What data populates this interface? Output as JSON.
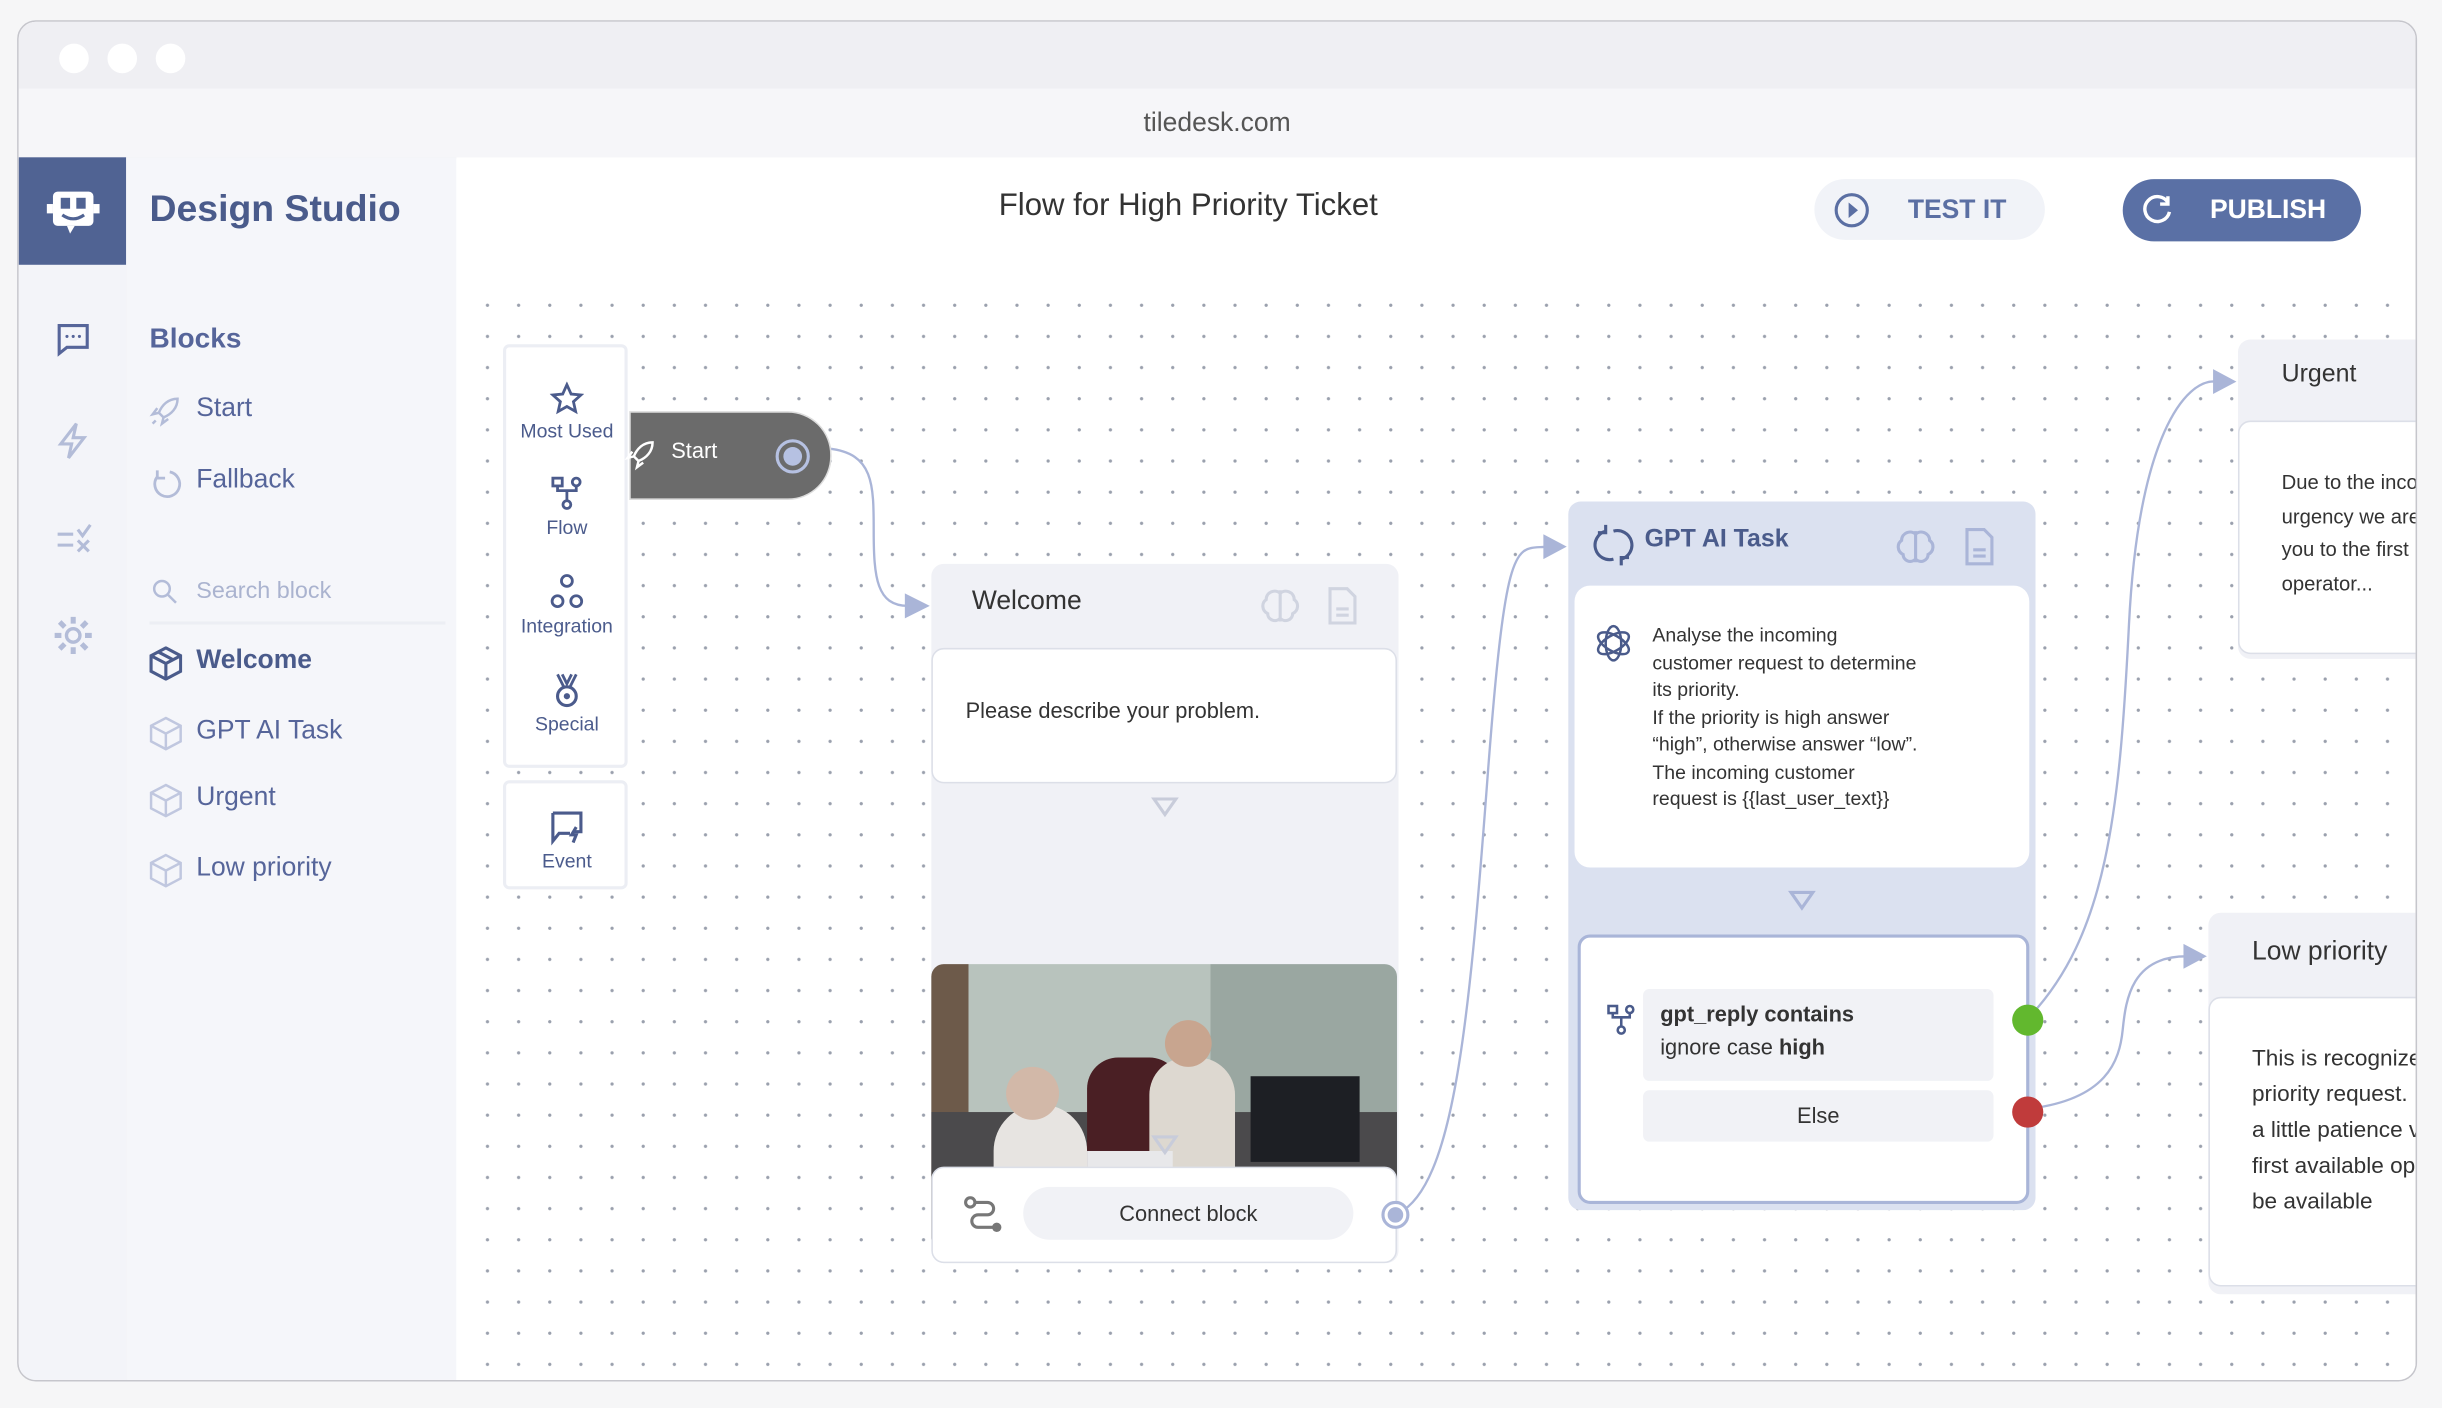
{
  "browser": {
    "url": "tiledesk.com"
  },
  "app": {
    "title": "Design Studio"
  },
  "sidebar": {
    "section": "Blocks",
    "fixed": [
      {
        "label": "Start",
        "icon": "rocket-icon"
      },
      {
        "label": "Fallback",
        "icon": "refresh-icon"
      }
    ],
    "search_placeholder": "Search block",
    "blocks": [
      {
        "label": "Welcome",
        "active": true
      },
      {
        "label": "GPT AI Task"
      },
      {
        "label": "Urgent"
      },
      {
        "label": "Low priority"
      }
    ]
  },
  "rail": [
    "chat-icon",
    "bolt-icon",
    "rules-icon",
    "gear-icon"
  ],
  "header": {
    "title": "Flow for High Priority Ticket",
    "test": "TEST IT",
    "publish": "PUBLISH"
  },
  "palette": {
    "items": [
      "Most Used",
      "Flow",
      "Integration",
      "Special"
    ],
    "event": "Event"
  },
  "canvas": {
    "start": {
      "label": "Start"
    },
    "welcome": {
      "title": "Welcome",
      "message": "Please describe your problem.",
      "connect": "Connect block"
    },
    "gpt": {
      "title": "GPT AI Task",
      "prompt": [
        "Analyse the incoming",
        "customer request to determine",
        "its priority.",
        "If the priority is high answer",
        "“high”, otherwise answer “low”.",
        "The incoming customer",
        "request is {{last_user_text}}"
      ],
      "condition": {
        "line1": "gpt_reply contains",
        "line2_prefix": "ignore case ",
        "line2_value": "high",
        "else": "Else"
      }
    },
    "urgent": {
      "title": "Urgent",
      "text": [
        "Due to the inco",
        "urgency we are",
        "you to the first",
        "operator..."
      ]
    },
    "low": {
      "title": "Low priority",
      "text": [
        "This is recognize",
        "priority request.",
        "a little patience v",
        "first available op",
        "be available"
      ]
    }
  },
  "colors": {
    "brand": "#506393",
    "accent": "#5a70a5",
    "true_port": "#62b82e",
    "false_port": "#c03b3b"
  }
}
